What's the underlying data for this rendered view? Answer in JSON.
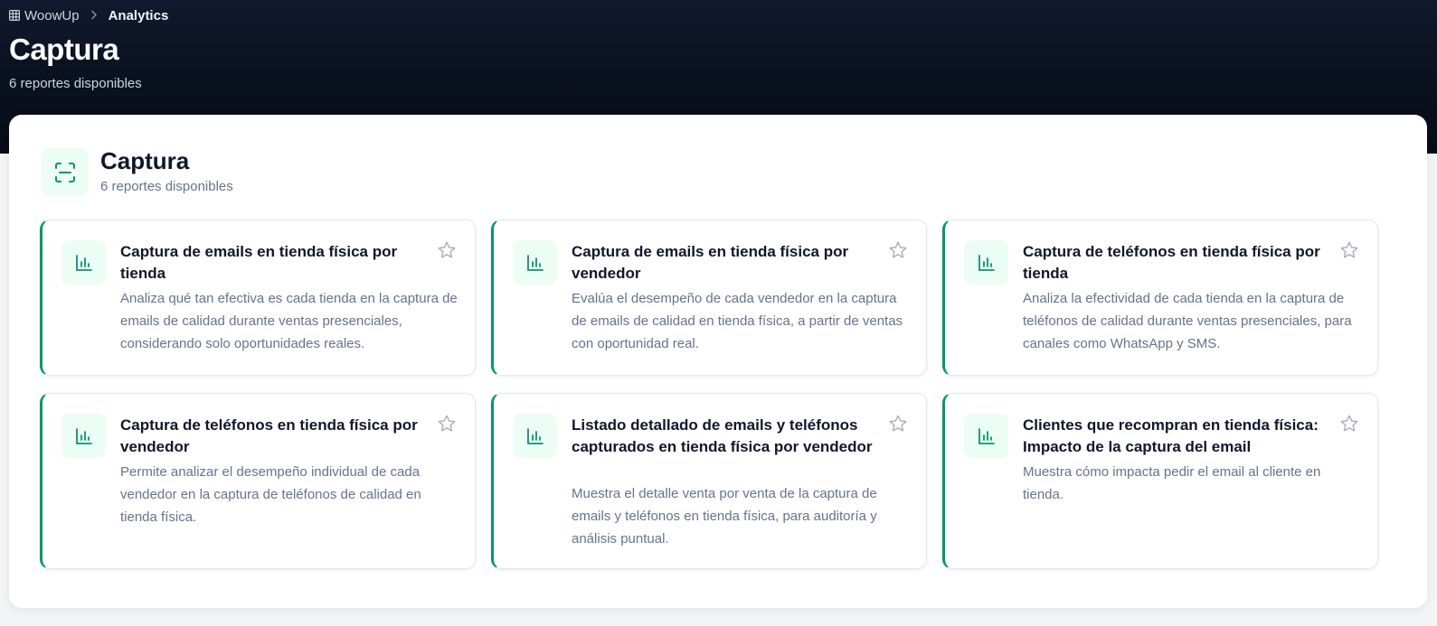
{
  "breadcrumb": {
    "home": "WoowUp",
    "current": "Analytics"
  },
  "header": {
    "title": "Captura",
    "subtitle": "6 reportes disponibles"
  },
  "section": {
    "title": "Captura",
    "subtitle": "6 reportes disponibles"
  },
  "icons": {
    "home": "grid-icon",
    "separator": "chevron-right-icon",
    "section": "scan-icon",
    "report": "bar-chart-icon",
    "favorite": "star-icon"
  },
  "colors": {
    "accent": "#079669",
    "accent_bg": "#ecfdf5",
    "hero_bg": "#0b1322"
  },
  "reports": [
    {
      "title": "Captura de emails en tienda física por tienda",
      "description": "Analiza qué tan efectiva es cada tienda en la captura de emails de calidad durante ventas presenciales, considerando solo oportunidades reales."
    },
    {
      "title": "Captura de emails en tienda física por vendedor",
      "description": "Evalúa el desempeño de cada vendedor en la captura de emails de calidad en tienda física, a partir de ventas con oportunidad real."
    },
    {
      "title": "Captura de teléfonos en tienda física por tienda",
      "description": "Analiza la efectividad de cada tienda en la captura de teléfonos de calidad durante ventas presenciales, para canales como WhatsApp y SMS."
    },
    {
      "title": "Captura de teléfonos en tienda física por vendedor",
      "description": "Permite analizar el desempeño individual de cada vendedor en la captura de teléfonos de calidad en tienda física."
    },
    {
      "title": "Listado detallado de emails y teléfonos capturados en tienda física por vendedor",
      "description": "Muestra el detalle venta por venta de la captura de emails y teléfonos en tienda física, para auditoría y análisis puntual."
    },
    {
      "title": "Clientes que recompran en tienda física: Impacto de la captura del email",
      "description": "Muestra cómo impacta pedir el email al cliente en tienda."
    }
  ]
}
